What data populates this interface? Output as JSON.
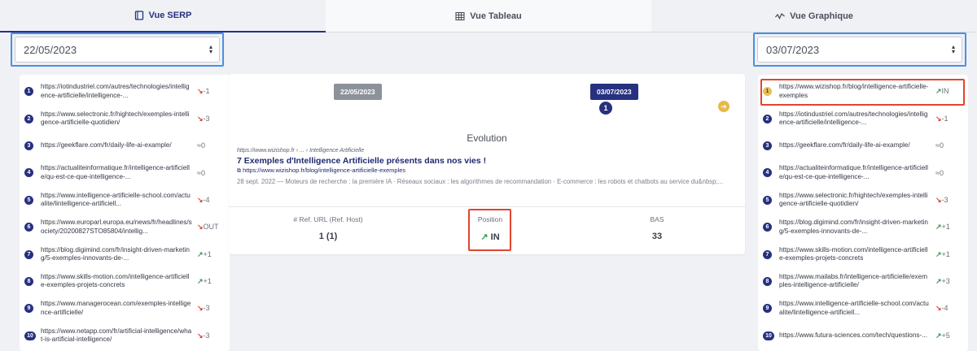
{
  "tabs": [
    {
      "label": "Vue SERP",
      "icon": "book-icon"
    },
    {
      "label": "Vue Tableau",
      "icon": "table-icon"
    },
    {
      "label": "Vue Graphique",
      "icon": "chart-line-icon"
    }
  ],
  "left_date": "22/05/2023",
  "right_date": "03/07/2023",
  "left_list": [
    {
      "rank": "1",
      "url": "https://iotindustriel.com/autres/technologies/intelligence-artificielle/intelligence-...",
      "change": "-1",
      "dir": "down"
    },
    {
      "rank": "2",
      "url": "https://www.selectronic.fr/hightech/exemples-intelligence-artificielle-quotidien/",
      "change": "-3",
      "dir": "down"
    },
    {
      "rank": "3",
      "url": "https://geekflare.com/fr/daily-life-ai-example/",
      "change": "0",
      "dir": "eq"
    },
    {
      "rank": "4",
      "url": "https://actualiteinformatique.fr/intelligence-artificielle/qu-est-ce-que-intelligence-...",
      "change": "0",
      "dir": "eq"
    },
    {
      "rank": "5",
      "url": "https://www.intelligence-artificielle-school.com/actualite/lintelligence-artificiell...",
      "change": "-4",
      "dir": "down"
    },
    {
      "rank": "6",
      "url": "https://www.europarl.europa.eu/news/fr/headlines/society/20200827STO85804/intellig...",
      "change": "OUT",
      "dir": "down"
    },
    {
      "rank": "7",
      "url": "https://blog.digimind.com/fr/insight-driven-marketing/5-exemples-innovants-de-...",
      "change": "+1",
      "dir": "up"
    },
    {
      "rank": "8",
      "url": "https://www.skills-motion.com/intelligence-artificielle-exemples-projets-concrets",
      "change": "+1",
      "dir": "up"
    },
    {
      "rank": "9",
      "url": "https://www.managerocean.com/exemples-intelligence-artificielle/",
      "change": "-3",
      "dir": "down"
    },
    {
      "rank": "10",
      "url": "https://www.netapp.com/fr/artificial-intelligence/what-is-artificial-intelligence/",
      "change": "-3",
      "dir": "down"
    }
  ],
  "right_list": [
    {
      "rank": "1",
      "url": "https://www.wizishop.fr/blog/intelligence-artificielle-exemples",
      "change": "IN",
      "dir": "up",
      "highlight": true
    },
    {
      "rank": "2",
      "url": "https://iotindustriel.com/autres/technologies/intelligence-artificielle/intelligence-...",
      "change": "-1",
      "dir": "down"
    },
    {
      "rank": "3",
      "url": "https://geekflare.com/fr/daily-life-ai-example/",
      "change": "0",
      "dir": "eq"
    },
    {
      "rank": "4",
      "url": "https://actualiteinformatique.fr/intelligence-artificielle/qu-est-ce-que-intelligence-...",
      "change": "0",
      "dir": "eq"
    },
    {
      "rank": "5",
      "url": "https://www.selectronic.fr/hightech/exemples-intelligence-artificielle-quotidien/",
      "change": "-3",
      "dir": "down"
    },
    {
      "rank": "6",
      "url": "https://blog.digimind.com/fr/insight-driven-marketing/5-exemples-innovants-de-...",
      "change": "+1",
      "dir": "up"
    },
    {
      "rank": "7",
      "url": "https://www.skills-motion.com/intelligence-artificielle-exemples-projets-concrets",
      "change": "+1",
      "dir": "up"
    },
    {
      "rank": "8",
      "url": "https://www.mailabs.fr/intelligence-artificielle/exemples-intelligence-artificielle/",
      "change": "+3",
      "dir": "up"
    },
    {
      "rank": "9",
      "url": "https://www.intelligence-artificielle-school.com/actualite/lintelligence-artificiell...",
      "change": "-4",
      "dir": "down"
    },
    {
      "rank": "10",
      "url": "https://www.futura-sciences.com/tech/questions-...",
      "change": "+5",
      "dir": "up"
    }
  ],
  "card": {
    "date_from": "22/05/2023",
    "date_to": "03/07/2023",
    "position_badge": "1",
    "evolution_title": "Evolution",
    "breadcrumb": "https://www.wizishop.fr › ... › Intelligence Artificielle",
    "result_title": "7 Exemples d'Intelligence Artificielle présents dans nos vies !",
    "result_url": "https://www.wizishop.fr/blog/intelligence-artificielle-exemples",
    "result_desc": "28 sept. 2022 — Moteurs de recherche : la première IA · Réseaux sociaux : les algorithmes de recommandation · E-commerce : les robots et chatbots au service du&nbsp;...",
    "stats": {
      "ref_label": "# Ref. URL (Ref. Host)",
      "ref_value": "1 (1)",
      "pos_label": "Position",
      "pos_value": "IN",
      "bas_label": "BAS",
      "bas_value": "33"
    }
  },
  "colors": {
    "navy": "#273180",
    "highlight": "#e2442f",
    "up": "#3a9a56",
    "down": "#d9443a",
    "gold": "#e8c158"
  }
}
